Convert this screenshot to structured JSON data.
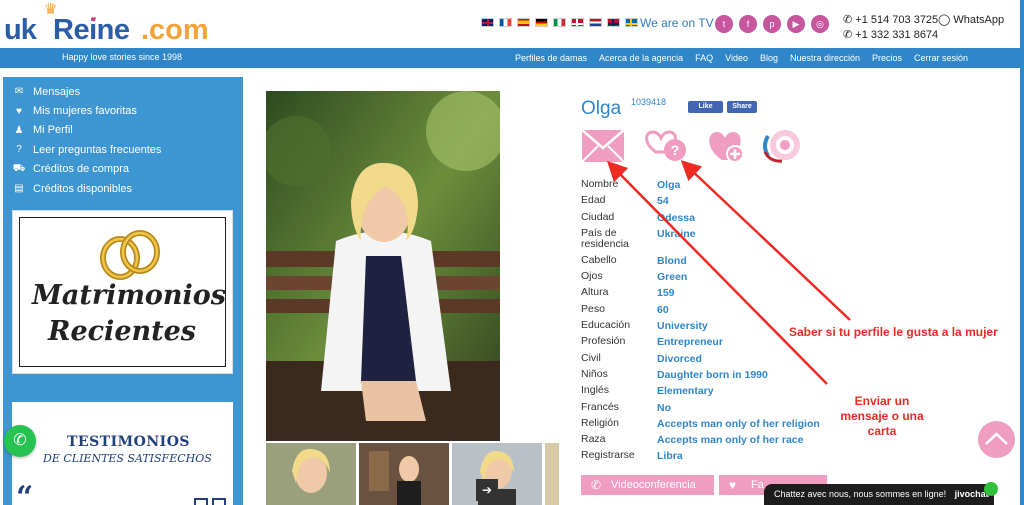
{
  "brand": {
    "logo_uk": "uk",
    "logo_reine": "Reine",
    "logo_com": ".com",
    "tagline": "Happy love stories since 1998"
  },
  "header": {
    "languages": [
      "English",
      "Français",
      "Español",
      "Deutsch",
      "Italiano",
      "Dansk",
      "Nederlands",
      "Norsk",
      "Svenska"
    ],
    "tv": "We are on TV",
    "socials": [
      "twitter-icon",
      "facebook-icon",
      "pinterest-icon",
      "youtube-icon",
      "instagram-icon"
    ],
    "phone1": "+1 514 703 3725",
    "phone2": "+1 332 331 8674",
    "whatsapp": "WhatsApp"
  },
  "nav": [
    "Perfiles de damas",
    "Acerca de la agencia",
    "FAQ",
    "Video",
    "Blog",
    "Nuestra dirección",
    "Precios",
    "Cerrar sesión"
  ],
  "sidebar": {
    "items": [
      {
        "label": "Mensajes",
        "icon": "envelope-icon"
      },
      {
        "label": "Mis mujeres favoritas",
        "icon": "heart-icon"
      },
      {
        "label": "Mi Perfil",
        "icon": "user-icon"
      },
      {
        "label": "Leer preguntas frecuentes",
        "icon": "question-icon"
      },
      {
        "label": "Créditos de compra",
        "icon": "cart-icon"
      },
      {
        "label": "Créditos disponibles",
        "icon": "credit-card-icon"
      }
    ],
    "banner1_line1": "Matrimonios",
    "banner1_line2": "Recientes",
    "banner2_title": "TESTIMONIOS",
    "banner2_subtitle": "DE CLIENTES SATISFECHOS"
  },
  "profile": {
    "name": "Olga",
    "id": "1039418",
    "fb_like": "Like",
    "fb_share": "Share",
    "fields": [
      {
        "label": "Nombre",
        "value": "Olga"
      },
      {
        "label": "Edad",
        "value": "54"
      },
      {
        "label": "Ciudad",
        "value": "Odessa"
      },
      {
        "label": "País de residencia",
        "value": "Ukraine"
      },
      {
        "label": "Cabello",
        "value": "Blond"
      },
      {
        "label": "Ojos",
        "value": "Green"
      },
      {
        "label": "Altura",
        "value": "159"
      },
      {
        "label": "Peso",
        "value": "60"
      },
      {
        "label": "Educación",
        "value": "University"
      },
      {
        "label": "Profesión",
        "value": "Entrepreneur"
      },
      {
        "label": "Civil",
        "value": "Divorced"
      },
      {
        "label": "Niños",
        "value": "Daughter born in 1990"
      },
      {
        "label": "Inglés",
        "value": "Elementary"
      },
      {
        "label": "Francés",
        "value": "No"
      },
      {
        "label": "Religión",
        "value": "Accepts man only of her religion"
      },
      {
        "label": "Raza",
        "value": "Accepts man only of her race"
      },
      {
        "label": "Registrarse",
        "value": "Libra"
      }
    ],
    "btn_video": "Videoconferencia",
    "btn_fav": "Fa"
  },
  "annotations": {
    "like_check": "Saber si tu perfile le gusta a la mujer",
    "send_message_line1": "Enviar un",
    "send_message_line2": "mensaje o una",
    "send_message_line3": "carta"
  },
  "chat": {
    "text": "Chattez avec nous, nous sommes en ligne!",
    "brand": "jivochat"
  },
  "colors": {
    "brand_blue": "#2f86c8",
    "sidebar_blue": "#3d96d1",
    "pink": "#ef9ec1",
    "annotation_red": "#ee2a24"
  }
}
